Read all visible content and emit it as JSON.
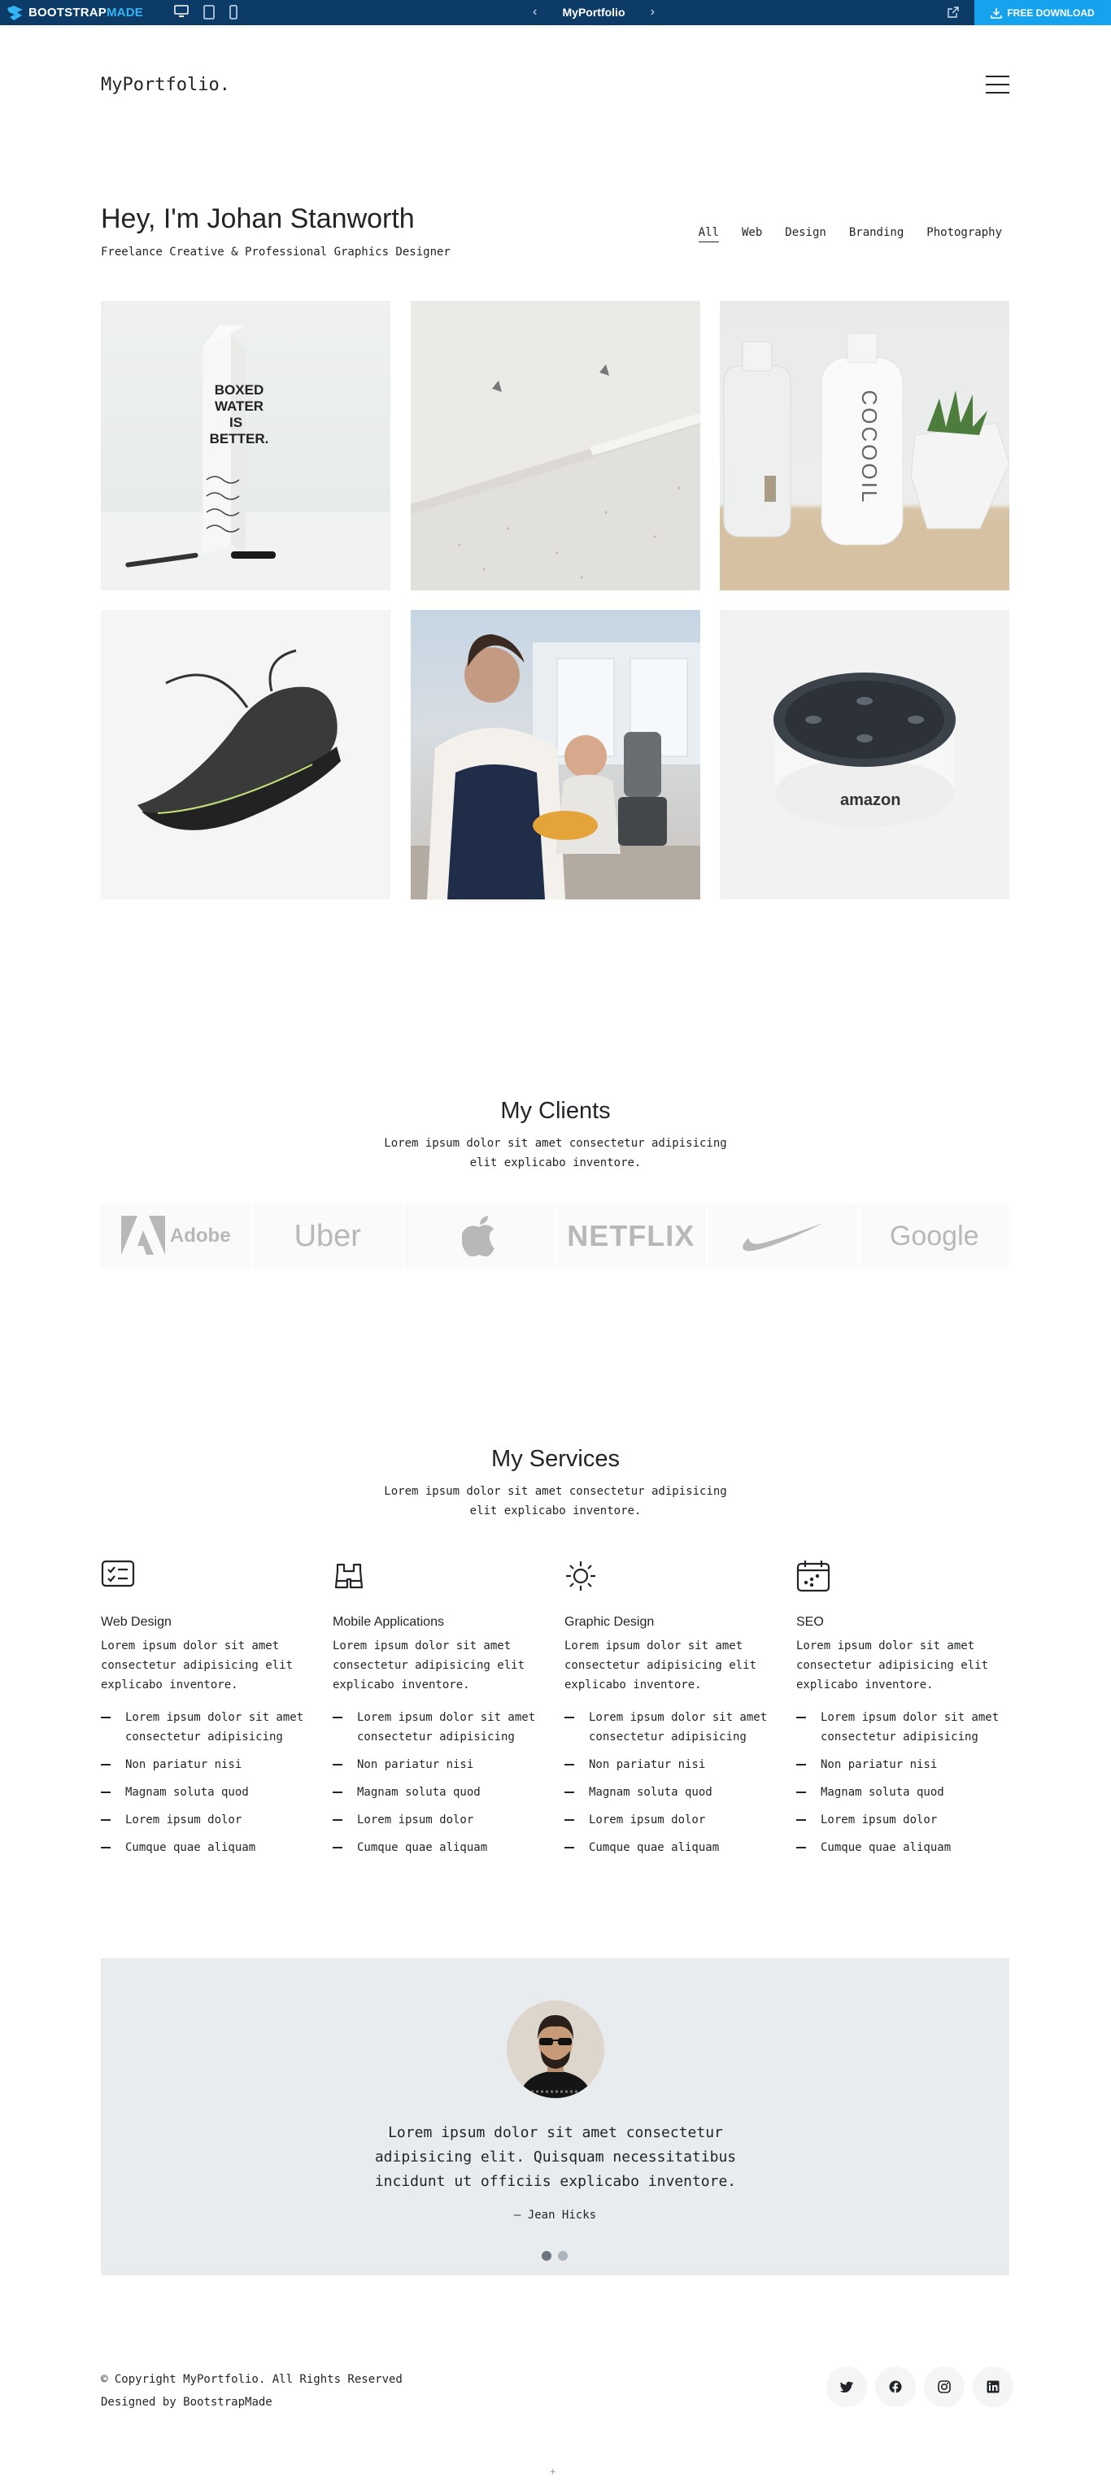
{
  "topbar": {
    "brand_a": "BOOTSTRAP",
    "brand_b": "MADE",
    "devices": [
      "desktop-icon",
      "tablet-icon",
      "mobile-icon"
    ],
    "template_name": "MyPortfolio",
    "download_label": "FREE DOWNLOAD"
  },
  "header": {
    "logo": "MyPortfolio."
  },
  "intro": {
    "title": "Hey, I'm Johan Stanworth",
    "subtitle": "Freelance Creative & Professional Graphics Designer"
  },
  "filters": [
    "All",
    "Web",
    "Design",
    "Branding",
    "Photography"
  ],
  "portfolio": [
    {
      "alt": "Boxed water carton with pen"
    },
    {
      "alt": "White wall with hooks"
    },
    {
      "alt": "Cocooil body oil bottle with plant"
    },
    {
      "alt": "Black running shoe"
    },
    {
      "alt": "Mother and son using blender"
    },
    {
      "alt": "Amazon Echo Dot speaker"
    }
  ],
  "clients": {
    "title": "My Clients",
    "description": "Lorem ipsum dolor sit amet consectetur adipisicing elit explicabo inventore.",
    "logos": [
      "Adobe",
      "Uber",
      "Apple",
      "NETFLIX",
      "Nike",
      "Google"
    ]
  },
  "services": {
    "title": "My Services",
    "description": "Lorem ipsum dolor sit amet consectetur adipisicing elit explicabo inventore.",
    "items": [
      {
        "icon": "checklist-icon",
        "title": "Web Design",
        "text": "Lorem ipsum dolor sit amet consectetur adipisicing elit explicabo inventore.",
        "list": [
          "Lorem ipsum dolor sit amet consectetur adipisicing",
          "Non pariatur nisi",
          "Magnam soluta quod",
          "Lorem ipsum dolor",
          "Cumque quae aliquam"
        ]
      },
      {
        "icon": "binoculars-icon",
        "title": "Mobile Applications",
        "text": "Lorem ipsum dolor sit amet consectetur adipisicing elit explicabo inventore.",
        "list": [
          "Lorem ipsum dolor sit amet consectetur adipisicing",
          "Non pariatur nisi",
          "Magnam soluta quod",
          "Lorem ipsum dolor",
          "Cumque quae aliquam"
        ]
      },
      {
        "icon": "sun-icon",
        "title": "Graphic Design",
        "text": "Lorem ipsum dolor sit amet consectetur adipisicing elit explicabo inventore.",
        "list": [
          "Lorem ipsum dolor sit amet consectetur adipisicing",
          "Non pariatur nisi",
          "Magnam soluta quod",
          "Lorem ipsum dolor",
          "Cumque quae aliquam"
        ]
      },
      {
        "icon": "calendar-icon",
        "title": "SEO",
        "text": "Lorem ipsum dolor sit amet consectetur adipisicing elit explicabo inventore.",
        "list": [
          "Lorem ipsum dolor sit amet consectetur adipisicing",
          "Non pariatur nisi",
          "Magnam soluta quod",
          "Lorem ipsum dolor",
          "Cumque quae aliquam"
        ]
      }
    ]
  },
  "testimonial": {
    "quote": "Lorem ipsum dolor sit amet consectetur adipisicing elit. Quisquam necessitatibus incidunt ut officiis explicabo inventore.",
    "author": "— Jean Hicks",
    "slides": 2,
    "active_slide": 1
  },
  "footer": {
    "copyright": "© Copyright MyPortfolio. All Rights Reserved",
    "credit_prefix": "Designed by",
    "credit_link": "BootstrapMade",
    "socials": [
      "twitter-icon",
      "facebook-icon",
      "instagram-icon",
      "linkedin-icon"
    ]
  },
  "colors": {
    "topbar": "#0b3b66",
    "download": "#16a3ee",
    "text": "#212529",
    "testimonial_bg": "#e9ecef"
  }
}
